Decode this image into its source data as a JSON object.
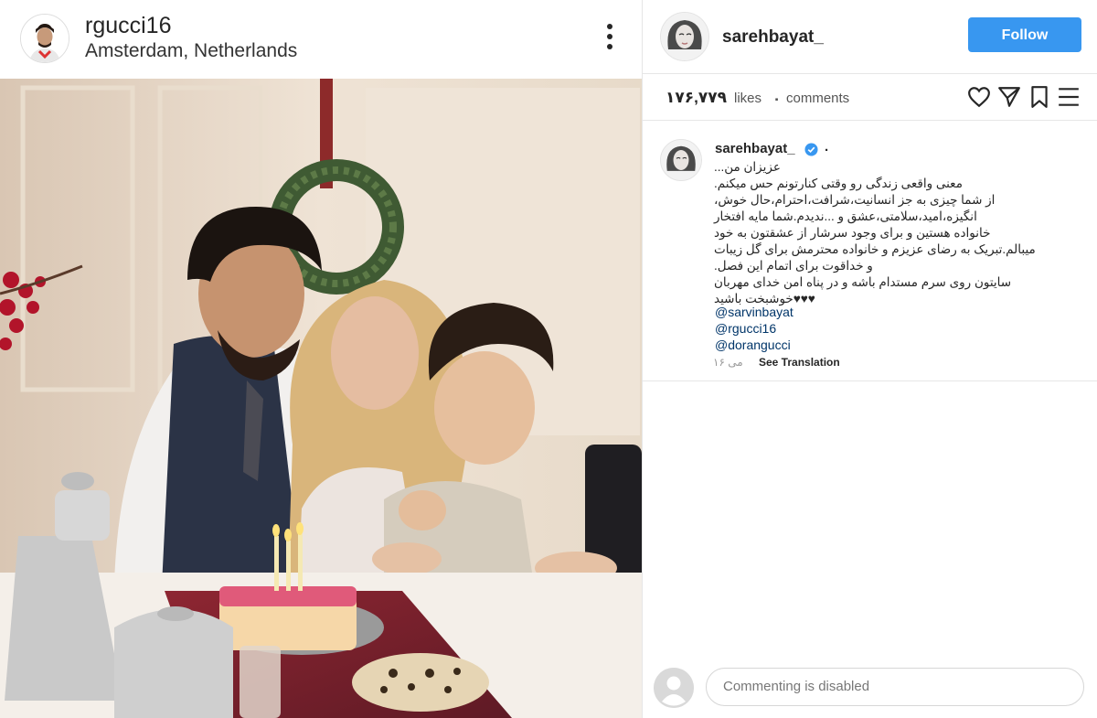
{
  "post_header": {
    "username": "rgucci16",
    "location": "Amsterdam, Netherlands"
  },
  "sidebar_header": {
    "username": "sarehbayat_",
    "follow_label": "Follow"
  },
  "stats": {
    "likes_count": "۱۷۶,۷۷۹",
    "likes_label": "likes",
    "comments_count": "۰",
    "comments_label": "comments"
  },
  "icons": [
    "heart-icon",
    "share-icon",
    "bookmark-icon",
    "menu-icon",
    "more-icon",
    "verified-icon",
    "user-icon"
  ],
  "colors": {
    "follow_button": "#3897f0",
    "mention": "#003569",
    "verified": "#3897f0"
  },
  "caption": {
    "username": "sarehbayat_",
    "dot": ".",
    "lines": [
      "عزیزان من...",
      "معنی واقعی زندگی رو وقتی کنارتونم حس میکنم.",
      "از شما چیزی به جز انسانیت،شرافت،احترام،حال خوش،",
      "انگیزه،امید،سلامتی،عشق و ...ندیدم.شما مایه افتخار",
      "خانواده هستین و برای وجود سرشار از عشقتون به خود",
      "میبالم.تبریک به رضای عزیزم و خانواده محترمش برای گل زیبات",
      "و خداقوت برای اتمام این فصل.",
      "سایتون روی سرم مستدام باشه و در پناه امن خدای مهربان",
      "♥♥♥خوشبخت باشید"
    ],
    "mentions": [
      "@sarvinbayat",
      "@rgucci16",
      "@dorangucci"
    ],
    "date": "می ۱۶",
    "see_translation": "See Translation"
  },
  "comment_bar": {
    "placeholder": "Commenting is disabled"
  }
}
